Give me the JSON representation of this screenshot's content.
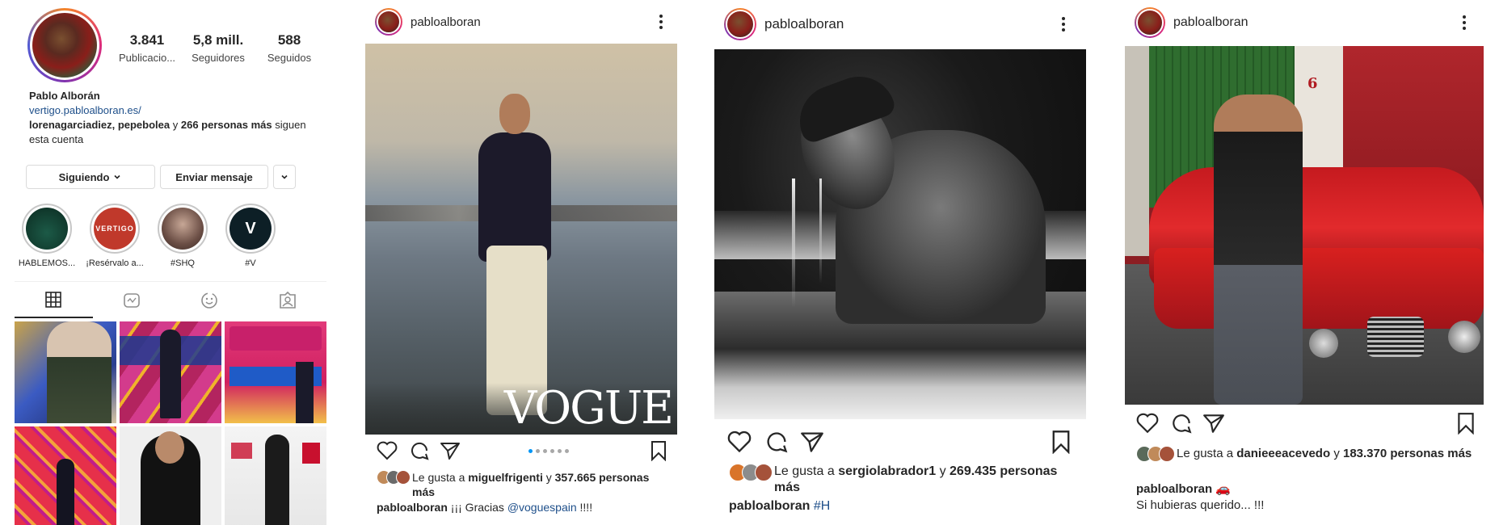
{
  "profile": {
    "stats": [
      {
        "num": "3.841",
        "label": "Publicacio..."
      },
      {
        "num": "5,8 mill.",
        "label": "Seguidores"
      },
      {
        "num": "588",
        "label": "Seguidos"
      }
    ],
    "name": "Pablo Alborán",
    "website": "vertigo.pabloalboran.es/",
    "followed_by_names": "lorenagarciadiez, pepebolea",
    "followed_by_join": "y",
    "followed_by_count": "266 personas más",
    "followed_by_suffix": "siguen esta cuenta",
    "buttons": {
      "following": "Siguiendo",
      "message": "Enviar mensaje"
    },
    "stories": [
      {
        "label": "HABLEMOS...",
        "color": "#0f3d30"
      },
      {
        "label": "¡Resérvalo a...",
        "color": "#c0392b",
        "text": "VERTIGO"
      },
      {
        "label": "#SHQ",
        "color": "#8c6f62"
      },
      {
        "label": "#V",
        "color": "#0d1f26",
        "text": "V"
      }
    ],
    "tab_icons": [
      "grid-icon",
      "reels-icon",
      "collab-icon",
      "tagged-icon"
    ]
  },
  "posts": [
    {
      "username": "pabloalboran",
      "likes_prefix": "Le gusta a",
      "likes_user": "miguelfrigenti",
      "likes_join": "y",
      "likes_count": "357.665 personas más",
      "caption_user": "pabloalboran",
      "caption_text": "¡¡¡ Gracias",
      "caption_tag": "@voguespain",
      "caption_end": "!!!!",
      "watermark": "VOGUE"
    },
    {
      "username": "pabloalboran",
      "likes_prefix": "Le gusta a",
      "likes_user": "sergiolabrador1",
      "likes_join": "y",
      "likes_count": "269.435 personas más",
      "caption_user": "pabloalboran",
      "caption_tag": "#H"
    },
    {
      "username": "pabloalboran",
      "likes_prefix": "Le gusta a",
      "likes_user": "danieeeacevedo",
      "likes_join": "y",
      "likes_count": "183.370 personas más",
      "caption_user": "pabloalboran",
      "caption_emoji": "🚗",
      "caption_text": "Si hubieras querido... !!!",
      "sign_number": "6"
    }
  ]
}
